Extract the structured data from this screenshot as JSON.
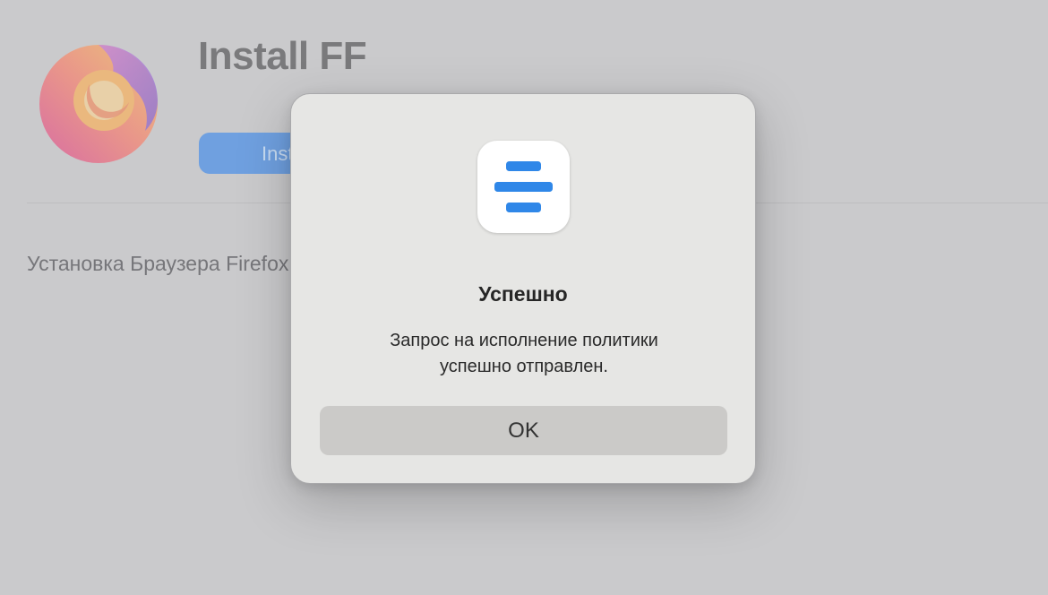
{
  "app": {
    "title": "Install FF",
    "install_button_label": "Install",
    "description": "Установка Браузера Firefox"
  },
  "dialog": {
    "title": "Успешно",
    "message_line1": "Запрос на исполнение политики",
    "message_line2": "успешно отправлен.",
    "ok_label": "OK",
    "icon": "three-bars-icon"
  },
  "colors": {
    "accent": "#2f87e8",
    "install_button": "#6fa0e0",
    "dialog_background": "#e6e6e4",
    "ok_button": "#cbcac8"
  }
}
